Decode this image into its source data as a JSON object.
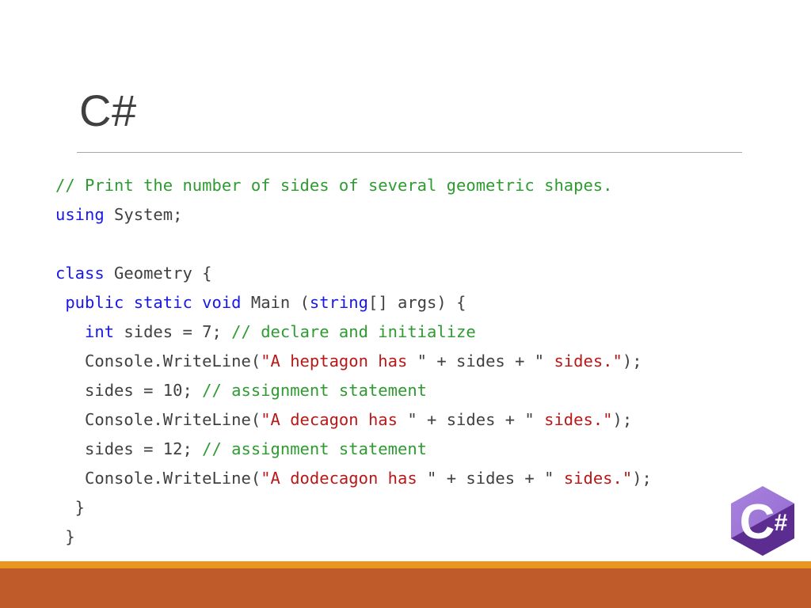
{
  "slide": {
    "title": "C#",
    "colors": {
      "title_text": "#404040",
      "rule": "#a6a6a6",
      "keyword_blue": "#1818e8",
      "comment_green": "#2e9b31",
      "string_red": "#b81818",
      "plain_text": "#404040",
      "strip_orange": "#e8961e",
      "strip_brown": "#bf5a2b",
      "logo_purple_light": "#9b6fd4",
      "logo_purple_dark": "#5c2d91"
    }
  },
  "code": {
    "language": "csharp",
    "lines": [
      {
        "id": "line-comment-header",
        "tokens": [
          {
            "t": "// Print the number of sides of several geometric shapes.",
            "k": "cmt"
          }
        ]
      },
      {
        "id": "line-using",
        "tokens": [
          {
            "t": "using",
            "k": "kw"
          },
          {
            "t": " System;",
            "k": "pln"
          }
        ]
      },
      {
        "id": "line-blank-1",
        "tokens": [
          {
            "t": " ",
            "k": "pln"
          }
        ]
      },
      {
        "id": "line-class",
        "tokens": [
          {
            "t": "class",
            "k": "kw"
          },
          {
            "t": " Geometry {",
            "k": "pln"
          }
        ]
      },
      {
        "id": "line-main-signature",
        "tokens": [
          {
            "t": " ",
            "k": "pln"
          },
          {
            "t": "public static void",
            "k": "kw"
          },
          {
            "t": " Main (",
            "k": "pln"
          },
          {
            "t": "string",
            "k": "kw"
          },
          {
            "t": "[] args) {",
            "k": "pln"
          }
        ]
      },
      {
        "id": "line-declare-sides",
        "tokens": [
          {
            "t": "   ",
            "k": "pln"
          },
          {
            "t": "int",
            "k": "kw"
          },
          {
            "t": " sides = 7; ",
            "k": "pln"
          },
          {
            "t": "// declare and initialize",
            "k": "cmt"
          }
        ]
      },
      {
        "id": "line-print-heptagon",
        "tokens": [
          {
            "t": "   Console.WriteLine(",
            "k": "pln"
          },
          {
            "t": "\"A heptagon has ",
            "k": "str"
          },
          {
            "t": "\" + sides + \" ",
            "k": "pln"
          },
          {
            "t": "sides.\"",
            "k": "str"
          },
          {
            "t": ");",
            "k": "pln"
          }
        ]
      },
      {
        "id": "line-assign-10",
        "tokens": [
          {
            "t": "   sides = 10; ",
            "k": "pln"
          },
          {
            "t": "// assignment statement",
            "k": "cmt"
          }
        ]
      },
      {
        "id": "line-print-decagon",
        "tokens": [
          {
            "t": "   Console.WriteLine(",
            "k": "pln"
          },
          {
            "t": "\"A decagon has ",
            "k": "str"
          },
          {
            "t": "\" + sides + \" ",
            "k": "pln"
          },
          {
            "t": "sides.\"",
            "k": "str"
          },
          {
            "t": ");",
            "k": "pln"
          }
        ]
      },
      {
        "id": "line-assign-12",
        "tokens": [
          {
            "t": "   sides = 12; ",
            "k": "pln"
          },
          {
            "t": "// assignment statement",
            "k": "cmt"
          }
        ]
      },
      {
        "id": "line-print-dodecagon",
        "tokens": [
          {
            "t": "   Console.WriteLine(",
            "k": "pln"
          },
          {
            "t": "\"A dodecagon has ",
            "k": "str"
          },
          {
            "t": "\" + sides + \" ",
            "k": "pln"
          },
          {
            "t": "sides.\"",
            "k": "str"
          },
          {
            "t": ");",
            "k": "pln"
          }
        ]
      },
      {
        "id": "line-close-main",
        "tokens": [
          {
            "t": "  }",
            "k": "pln"
          }
        ]
      },
      {
        "id": "line-close-class",
        "tokens": [
          {
            "t": " }",
            "k": "pln"
          }
        ]
      }
    ]
  },
  "logo": {
    "name": "csharp-logo",
    "letter": "C",
    "sharp": "#"
  }
}
